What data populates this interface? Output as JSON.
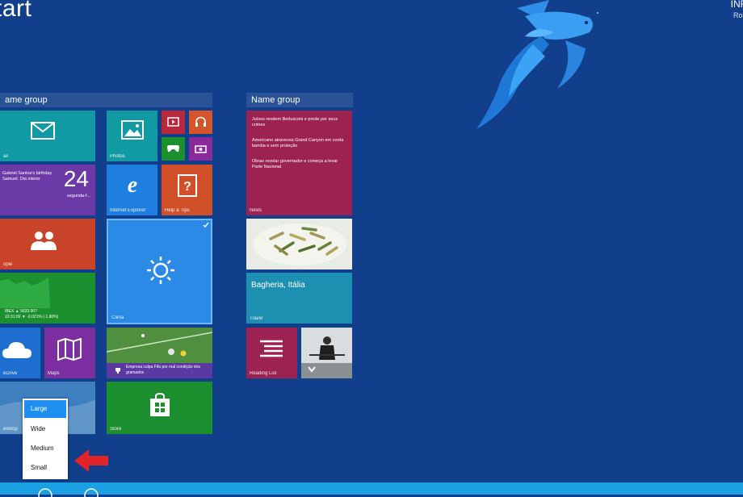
{
  "screen": {
    "title": "tart"
  },
  "user": {
    "name": "INF",
    "sub": "Ros"
  },
  "groups": [
    {
      "name": "ame group"
    },
    {
      "name": "Name group"
    }
  ],
  "tiles": {
    "mail": {
      "label": "ail"
    },
    "calendar": {
      "event": "Gabriel Santos's birthday\nSamuel. Dia inteiro",
      "day": "24",
      "weekday": "segunda-f..."
    },
    "photos": {
      "label": "Photos"
    },
    "ie": {
      "label": "Internet Explorer"
    },
    "help": {
      "label": "Help & Tips"
    },
    "people": {
      "label": "ople"
    },
    "weather": {
      "label": "Clima"
    },
    "finance": {
      "line1": "IBEX ▲ 5633.907",
      "line2": "10:31:00 ▼ -0.021% (-1.80%)"
    },
    "onedrive": {
      "label": "eDrive"
    },
    "maps": {
      "label": "Maps"
    },
    "sports": {
      "headline": "Empresa culpa Fifa por mal condição dos gramados"
    },
    "desktop": {
      "label": "esktop"
    },
    "store": {
      "label": "Store"
    },
    "news": {
      "items": [
        "Juízes rendem Berlusconi e prede por seus crimes",
        "Americano atravessa Grand Canyon em corda bamba e sem proteção",
        "Obras revelar governador e começa a levar Parte Nacional"
      ],
      "label": "News"
    },
    "travel": {
      "place": "Bagheria, Itália",
      "label": "Travel"
    },
    "reading": {
      "label": "Reading List"
    }
  },
  "resize_menu": {
    "options": [
      "Large",
      "Wide",
      "Medium",
      "Small"
    ],
    "selected": "Large"
  },
  "colors": {
    "background": "#123f8c",
    "teal": "#119aa4",
    "purple": "#6b3aa6",
    "orange": "#d14a24",
    "green": "#1c8f2e",
    "magenta": "#9b2251",
    "light_blue": "#2b8ae6",
    "arrow": "#e0242a",
    "appbar": "#1ba1e2"
  }
}
